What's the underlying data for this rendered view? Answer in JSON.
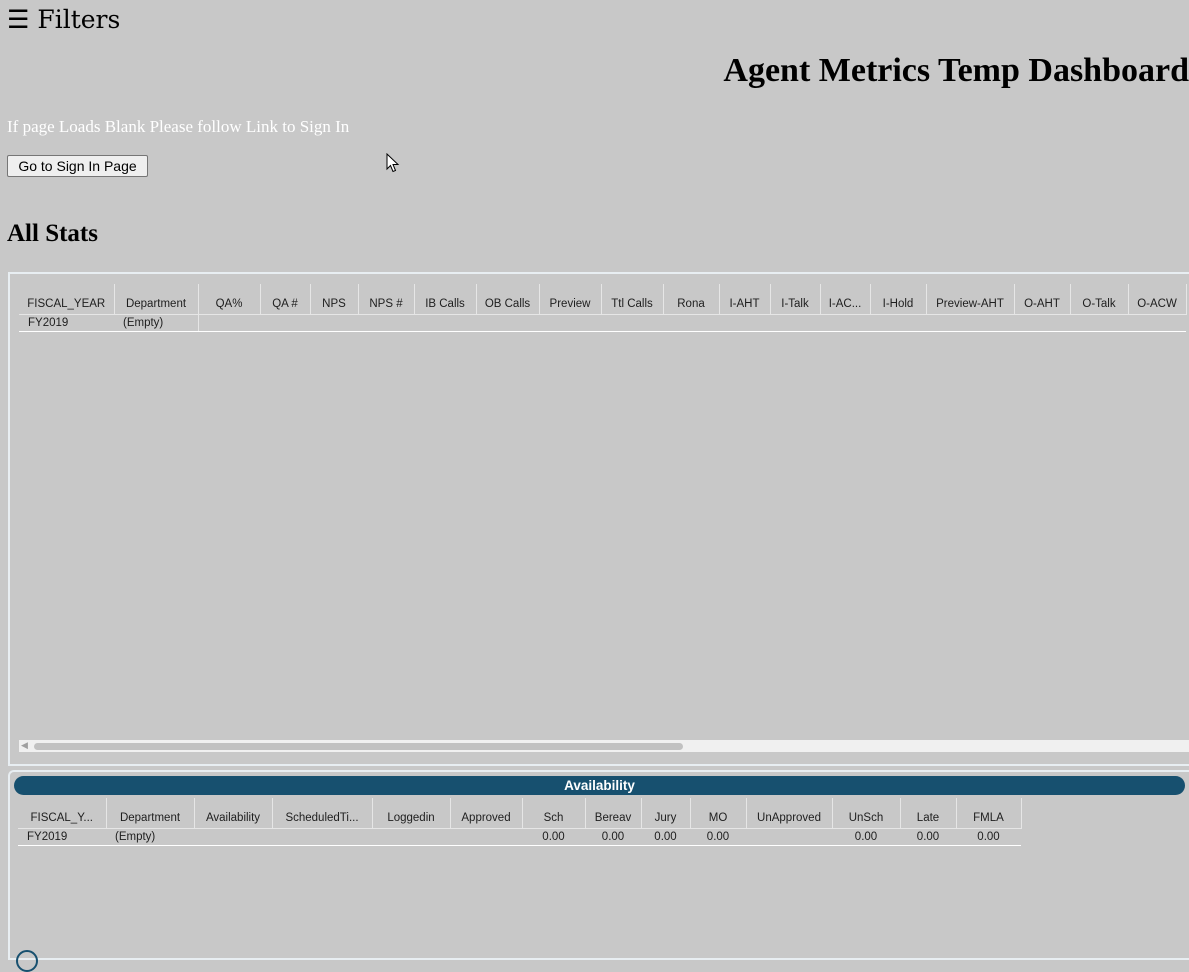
{
  "filters": {
    "icon": "☰",
    "label": "Filters"
  },
  "title": "Agent Metrics Temp Dashboard",
  "sign_in": {
    "note": "If page Loads Blank Please follow Link to Sign In",
    "button": "Go to Sign In Page"
  },
  "all_stats": {
    "title": "All Stats",
    "columns": [
      "FISCAL_YEAR",
      "Department",
      "QA%",
      "QA #",
      "NPS",
      "NPS #",
      "IB Calls",
      "OB Calls",
      "Preview",
      "Ttl Calls",
      "Rona",
      "I-AHT",
      "I-Talk",
      "I-AC...",
      "I-Hold",
      "Preview-AHT",
      "O-AHT",
      "O-Talk",
      "O-ACW"
    ],
    "rows": [
      [
        "FY2019",
        "(Empty)",
        "",
        "",
        "",
        "",
        "",
        "",
        "",
        "",
        "",
        "",
        "",
        "",
        "",
        "",
        "",
        "",
        ""
      ]
    ]
  },
  "availability": {
    "title": "Availability",
    "columns": [
      "FISCAL_Y...",
      "Department",
      "Availability",
      "ScheduledTi...",
      "Loggedin",
      "Approved",
      "Sch",
      "Bereav",
      "Jury",
      "MO",
      "UnApproved",
      "UnSch",
      "Late",
      "FMLA"
    ],
    "rows": [
      [
        "FY2019",
        "(Empty)",
        "",
        "",
        "",
        "",
        "0.00",
        "0.00",
        "0.00",
        "0.00",
        "",
        "0.00",
        "0.00",
        "0.00"
      ]
    ]
  }
}
